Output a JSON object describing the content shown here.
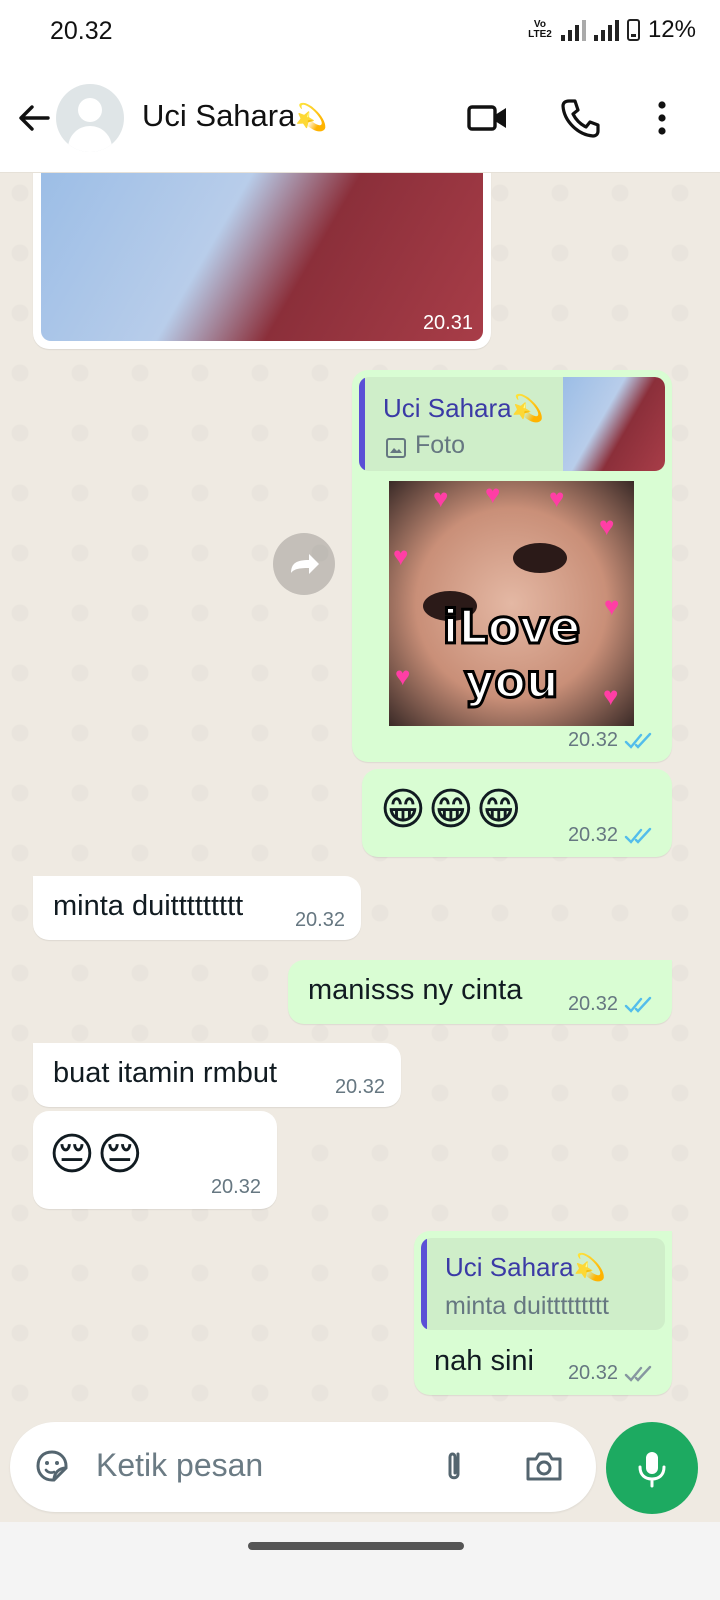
{
  "status_bar": {
    "time": "20.32",
    "network": "4G",
    "volte": "Vo LTE2",
    "battery": "12%"
  },
  "header": {
    "contact_name": "Uci Sahara",
    "name_emoji": "💫",
    "video_icon": "video-call-icon",
    "call_icon": "phone-icon",
    "menu_icon": "more-vert-icon"
  },
  "messages": [
    {
      "dir": "in",
      "type": "image",
      "time": "20.31"
    },
    {
      "dir": "out",
      "type": "sticker-reply",
      "quote_name": "Uci Sahara💫",
      "quote_label": "Foto",
      "sticker_text": "iLove you",
      "time": "20.32",
      "status": "read"
    },
    {
      "dir": "out",
      "type": "emoji",
      "text": "😁😁😁",
      "time": "20.32",
      "status": "read"
    },
    {
      "dir": "in",
      "type": "text",
      "text": "minta duittttttttt",
      "time": "20.32"
    },
    {
      "dir": "out",
      "type": "text",
      "text": "manisss ny cinta",
      "time": "20.32",
      "status": "read"
    },
    {
      "dir": "in",
      "type": "text",
      "text": "buat itamin rmbut",
      "time": "20.32"
    },
    {
      "dir": "in",
      "type": "emoji",
      "text": "😔😔",
      "time": "20.32"
    },
    {
      "dir": "out",
      "type": "text-reply",
      "quote_name": "Uci Sahara💫",
      "quote_text": "minta duittttttttt",
      "text": "nah sini",
      "time": "20.32",
      "status": "delivered"
    }
  ],
  "input": {
    "placeholder": "Ketik pesan"
  },
  "colors": {
    "outgoing_bubble": "#d9fdd3",
    "incoming_bubble": "#ffffff",
    "read_tick": "#53bdeb",
    "mic_button": "#1daa61"
  }
}
